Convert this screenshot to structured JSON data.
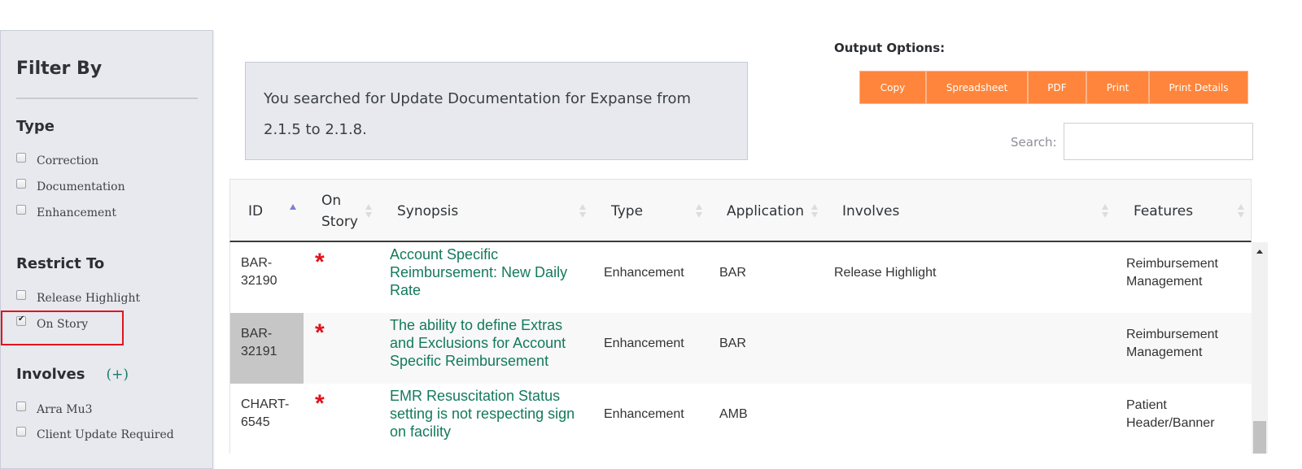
{
  "sidebar": {
    "title": "Filter By",
    "type_heading": "Type",
    "type_items": [
      {
        "label": "Correction",
        "checked": false
      },
      {
        "label": "Documentation",
        "checked": false
      },
      {
        "label": "Enhancement",
        "checked": false
      }
    ],
    "restrict_heading": "Restrict To",
    "restrict_items": [
      {
        "label": "Release Highlight",
        "checked": false
      },
      {
        "label": "On Story",
        "checked": true
      }
    ],
    "involves_heading": "Involves",
    "involves_expand": "(+)",
    "involves_items": [
      {
        "label": "Arra Mu3",
        "checked": false
      },
      {
        "label": "Client Update Required",
        "checked": false
      }
    ]
  },
  "summary": {
    "text": "You searched for Update Documentation for Expanse from 2.1.5 to 2.1.8."
  },
  "output": {
    "label": "Output Options:",
    "buttons": [
      "Copy",
      "Spreadsheet",
      "PDF",
      "Print",
      "Print Details"
    ],
    "search_label": "Search:",
    "search_value": "",
    "accent_color": "#fe853b"
  },
  "table": {
    "columns": [
      "ID",
      "On Story",
      "Synopsis",
      "Type",
      "Application",
      "Involves",
      "Features"
    ],
    "sorted_column": "ID",
    "sort_direction": "ascending",
    "rows": [
      {
        "id": "BAR-32190",
        "on_story": "*",
        "synopsis": "Account Specific Reimbursement: New Daily Rate",
        "type": "Enhancement",
        "application": "BAR",
        "involves": "Release Highlight",
        "features": "Reimbursement Management"
      },
      {
        "id": "BAR-32191",
        "on_story": "*",
        "synopsis": "The ability to define Extras and Exclusions for Account Specific Reimbursement",
        "type": "Enhancement",
        "application": "BAR",
        "involves": "",
        "features": "Reimbursement Management"
      },
      {
        "id": "CHART-6545",
        "on_story": "*",
        "synopsis": "EMR Resuscitation Status setting is not respecting sign on facility",
        "type": "Enhancement",
        "application": "AMB",
        "involves": "",
        "features": "Patient Header/Banner"
      }
    ]
  }
}
